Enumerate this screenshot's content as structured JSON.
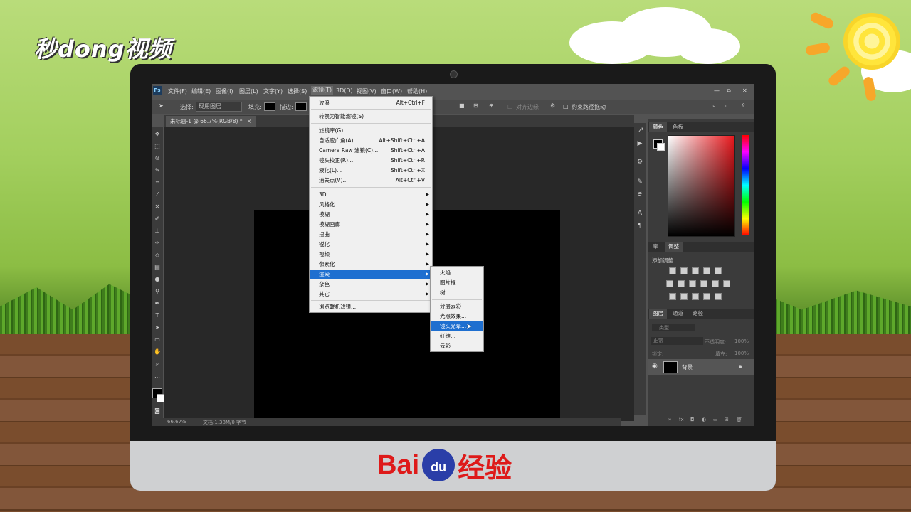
{
  "brand": {
    "logo_text": "秒dong视频",
    "bottom_brand_bai": "Bai",
    "bottom_brand_du": "du",
    "bottom_brand_suffix": "经验"
  },
  "app": {
    "icon_text": "Ps",
    "menu": [
      "文件(F)",
      "编辑(E)",
      "图像(I)",
      "图层(L)",
      "文字(Y)",
      "选择(S)",
      "滤镜(T)",
      "3D(D)",
      "视图(V)",
      "窗口(W)",
      "帮助(H)"
    ],
    "window_controls": [
      "—",
      "⧉",
      "✕"
    ]
  },
  "options_bar": {
    "select_label": "选择:",
    "select_value": "现用图层",
    "fill_label": "填充:",
    "stroke_label": "描边:",
    "align_edges": "对齐边缘",
    "constrain_path": "约束路径拖动"
  },
  "document_tab": {
    "title": "未标题-1 @ 66.7%(RGB/8) *",
    "close": "×"
  },
  "status_bar": {
    "zoom": "66.67%",
    "doc_info": "文档:1.38M/0 字节"
  },
  "filter_menu": {
    "items": [
      {
        "label": "波浪",
        "shortcut": "Alt+Ctrl+F"
      },
      {
        "label": "转换为智能滤镜(S)",
        "shortcut": ""
      },
      {
        "label": "滤镜库(G)...",
        "shortcut": ""
      },
      {
        "label": "自适应广角(A)...",
        "shortcut": "Alt+Shift+Ctrl+A"
      },
      {
        "label": "Camera Raw 滤镜(C)...",
        "shortcut": "Shift+Ctrl+A"
      },
      {
        "label": "镜头校正(R)...",
        "shortcut": "Shift+Ctrl+R"
      },
      {
        "label": "液化(L)...",
        "shortcut": "Shift+Ctrl+X"
      },
      {
        "label": "消失点(V)...",
        "shortcut": "Alt+Ctrl+V"
      },
      {
        "label": "3D",
        "shortcut": ""
      },
      {
        "label": "风格化",
        "shortcut": ""
      },
      {
        "label": "模糊",
        "shortcut": ""
      },
      {
        "label": "模糊画廊",
        "shortcut": ""
      },
      {
        "label": "扭曲",
        "shortcut": ""
      },
      {
        "label": "锐化",
        "shortcut": ""
      },
      {
        "label": "视频",
        "shortcut": ""
      },
      {
        "label": "像素化",
        "shortcut": ""
      },
      {
        "label": "渲染",
        "shortcut": ""
      },
      {
        "label": "杂色",
        "shortcut": ""
      },
      {
        "label": "其它",
        "shortcut": ""
      },
      {
        "label": "浏览联机滤镜...",
        "shortcut": ""
      }
    ]
  },
  "render_submenu": {
    "items": [
      "火焰...",
      "图片框...",
      "树...",
      "分层云彩",
      "光照效果...",
      "镜头光晕...",
      "纤维...",
      "云彩"
    ],
    "highlighted": "镜头光晕..."
  },
  "color_panel": {
    "tabs": [
      "颜色",
      "色板"
    ]
  },
  "adjust_panel": {
    "tabs": [
      "库",
      "调整"
    ],
    "add_label": "添加调整"
  },
  "layers_panel": {
    "tabs": [
      "图层",
      "通道",
      "路径"
    ],
    "filter_placeholder": "类型",
    "blend_mode": "正常",
    "opacity_label": "不透明度:",
    "opacity_value": "100%",
    "lock_label": "锁定:",
    "fill_label": "填充:",
    "fill_value": "100%",
    "layer_name": "背景"
  },
  "colors": {
    "menu_highlight": "#1e6fd0",
    "ps_panel": "#535353",
    "canvas_bg": "#282828"
  }
}
